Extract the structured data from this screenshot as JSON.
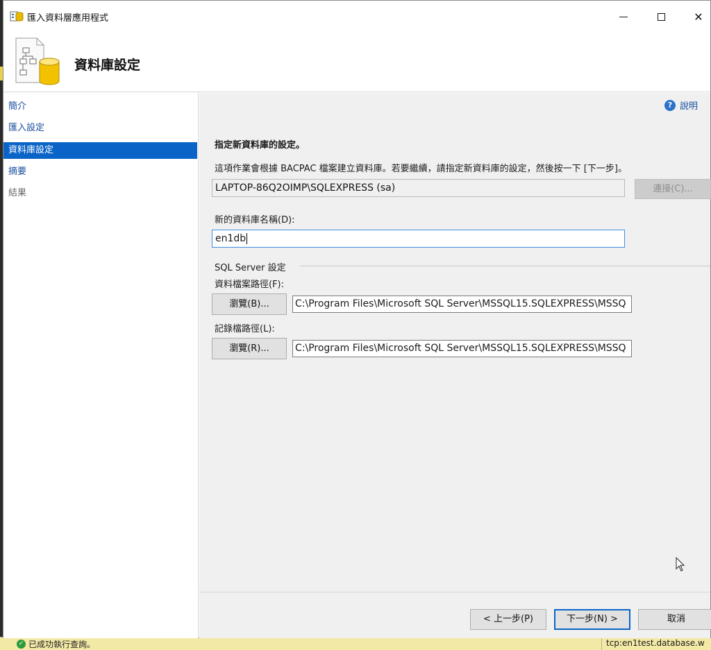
{
  "background": {
    "status_message": "已成功執行查詢。",
    "connection_text": "tcp:en1test.database.w"
  },
  "window": {
    "title": "匯入資料層應用程式",
    "minimize": "─",
    "maximize": "☐",
    "close": "✕"
  },
  "header": {
    "title": "資料庫設定"
  },
  "sidebar": {
    "items": [
      {
        "label": "簡介"
      },
      {
        "label": "匯入設定"
      },
      {
        "label": "資料庫設定"
      },
      {
        "label": "摘要"
      },
      {
        "label": "結果"
      }
    ],
    "active_index": 2
  },
  "help": {
    "label": "說明"
  },
  "main": {
    "section_title": "指定新資料庫的設定。",
    "description": "這項作業會根據 BACPAC 檔案建立資料庫。若要繼續，請指定新資料庫的設定，然後按一下 [下一步]。",
    "server_connection": "LAPTOP-86Q2OIMP\\SQLEXPRESS (sa)",
    "connect_button": "連接(C)...",
    "db_name_label": "新的資料庫名稱(D):",
    "db_name_value": "en1db",
    "group_label": "SQL Server 設定",
    "data_path_label": "資料檔案路徑(F):",
    "data_browse_button": "瀏覽(B)...",
    "data_path_value": "C:\\Program Files\\Microsoft SQL Server\\MSSQL15.SQLEXPRESS\\MSSQ",
    "log_path_label": "記錄檔路徑(L):",
    "log_browse_button": "瀏覽(R)...",
    "log_path_value": "C:\\Program Files\\Microsoft SQL Server\\MSSQL15.SQLEXPRESS\\MSSQ"
  },
  "footer": {
    "back_button": "< 上一步(P)",
    "next_button": "下一步(N) >",
    "cancel_button": "取消"
  },
  "colors": {
    "accent": "#0a64c8",
    "link": "#1a4ea0",
    "content_bg": "#f0f0f0"
  }
}
